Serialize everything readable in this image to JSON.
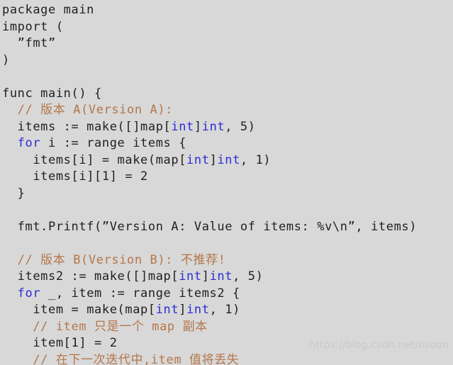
{
  "editor": {
    "language": "go",
    "background_color": "#d8d8d8",
    "text_color": "#1f1f1f",
    "comment_color": "#b5764a",
    "keyword_color": "#2b2bd6",
    "watermark_color": "#c9c9c9"
  },
  "watermark": {
    "text": "https://blog.csdn.net/osoon"
  },
  "code": {
    "lines": [
      {
        "indent": 0,
        "tokens": [
          {
            "t": "package main",
            "k": "plain"
          }
        ]
      },
      {
        "indent": 0,
        "tokens": [
          {
            "t": "import (",
            "k": "plain"
          }
        ]
      },
      {
        "indent": 2,
        "tokens": [
          {
            "t": "”fmt”",
            "k": "str"
          }
        ]
      },
      {
        "indent": 0,
        "tokens": [
          {
            "t": ")",
            "k": "plain"
          }
        ]
      },
      {
        "indent": 0,
        "tokens": [
          {
            "t": "",
            "k": "plain"
          }
        ]
      },
      {
        "indent": 0,
        "tokens": [
          {
            "t": "func main() {",
            "k": "plain"
          }
        ]
      },
      {
        "indent": 2,
        "tokens": [
          {
            "t": "// 版本 A(Version A):",
            "k": "comment"
          }
        ]
      },
      {
        "indent": 2,
        "tokens": [
          {
            "t": "items := make([]map[",
            "k": "plain"
          },
          {
            "t": "int",
            "k": "type"
          },
          {
            "t": "]",
            "k": "plain"
          },
          {
            "t": "int",
            "k": "type"
          },
          {
            "t": ", 5)",
            "k": "plain"
          }
        ]
      },
      {
        "indent": 2,
        "tokens": [
          {
            "t": "for",
            "k": "kw"
          },
          {
            "t": " i := range items {",
            "k": "plain"
          }
        ]
      },
      {
        "indent": 4,
        "tokens": [
          {
            "t": "items[i] = make(map[",
            "k": "plain"
          },
          {
            "t": "int",
            "k": "type"
          },
          {
            "t": "]",
            "k": "plain"
          },
          {
            "t": "int",
            "k": "type"
          },
          {
            "t": ", 1)",
            "k": "plain"
          }
        ]
      },
      {
        "indent": 4,
        "tokens": [
          {
            "t": "items[i][1] = 2",
            "k": "plain"
          }
        ]
      },
      {
        "indent": 2,
        "tokens": [
          {
            "t": "}",
            "k": "plain"
          }
        ]
      },
      {
        "indent": 0,
        "tokens": [
          {
            "t": "",
            "k": "plain"
          }
        ]
      },
      {
        "indent": 2,
        "tokens": [
          {
            "t": "fmt.Printf(”Version A: Value of items: %v\\n”, items)",
            "k": "plain"
          }
        ]
      },
      {
        "indent": 0,
        "tokens": [
          {
            "t": "",
            "k": "plain"
          }
        ]
      },
      {
        "indent": 2,
        "tokens": [
          {
            "t": "// 版本 B(Version B): 不推荐!",
            "k": "comment"
          }
        ]
      },
      {
        "indent": 2,
        "tokens": [
          {
            "t": "items2 := make([]map[",
            "k": "plain"
          },
          {
            "t": "int",
            "k": "type"
          },
          {
            "t": "]",
            "k": "plain"
          },
          {
            "t": "int",
            "k": "type"
          },
          {
            "t": ", 5)",
            "k": "plain"
          }
        ]
      },
      {
        "indent": 2,
        "tokens": [
          {
            "t": "for",
            "k": "kw"
          },
          {
            "t": " _, item := range items2 {",
            "k": "plain"
          }
        ]
      },
      {
        "indent": 4,
        "tokens": [
          {
            "t": "item = make(map[",
            "k": "plain"
          },
          {
            "t": "int",
            "k": "type"
          },
          {
            "t": "]",
            "k": "plain"
          },
          {
            "t": "int",
            "k": "type"
          },
          {
            "t": ", 1)",
            "k": "plain"
          }
        ]
      },
      {
        "indent": 4,
        "tokens": [
          {
            "t": "// item 只是一个 map 副本",
            "k": "comment"
          }
        ]
      },
      {
        "indent": 4,
        "tokens": [
          {
            "t": "item[1] = 2",
            "k": "plain"
          }
        ]
      },
      {
        "indent": 4,
        "tokens": [
          {
            "t": "// 在下一次迭代中,item 值将丢失",
            "k": "comment"
          }
        ]
      }
    ]
  }
}
